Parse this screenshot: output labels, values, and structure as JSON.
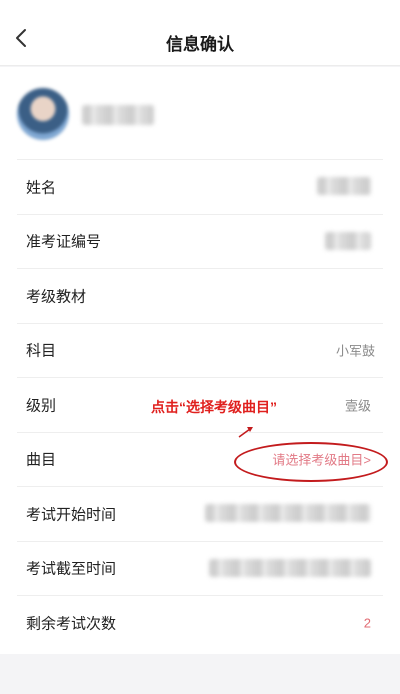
{
  "header": {
    "title": "信息确认",
    "back_icon": "chevron-left-icon"
  },
  "profile": {
    "avatar": "avatar (blurred)",
    "name_obscured": true
  },
  "rows": [
    {
      "label": "姓名",
      "value": "",
      "obscured": true
    },
    {
      "label": "准考证编号",
      "value": "",
      "obscured": true
    },
    {
      "label": "考级教材",
      "value": ""
    },
    {
      "label": "科目",
      "value": "小军鼓"
    },
    {
      "label": "级别",
      "value": "壹级"
    },
    {
      "label": "曲目",
      "value": "请选择考级曲目>"
    },
    {
      "label": "考试开始时间",
      "value": "",
      "obscured": true
    },
    {
      "label": "考试截至时间",
      "value": "",
      "obscured": true
    },
    {
      "label": "剩余考试次数",
      "value": "2"
    }
  ],
  "annotation": {
    "text": "点击“选择考级曲目”",
    "color": "#e0201e"
  },
  "colors": {
    "accent_link": "#e27a86",
    "count_red": "#e26b73"
  }
}
